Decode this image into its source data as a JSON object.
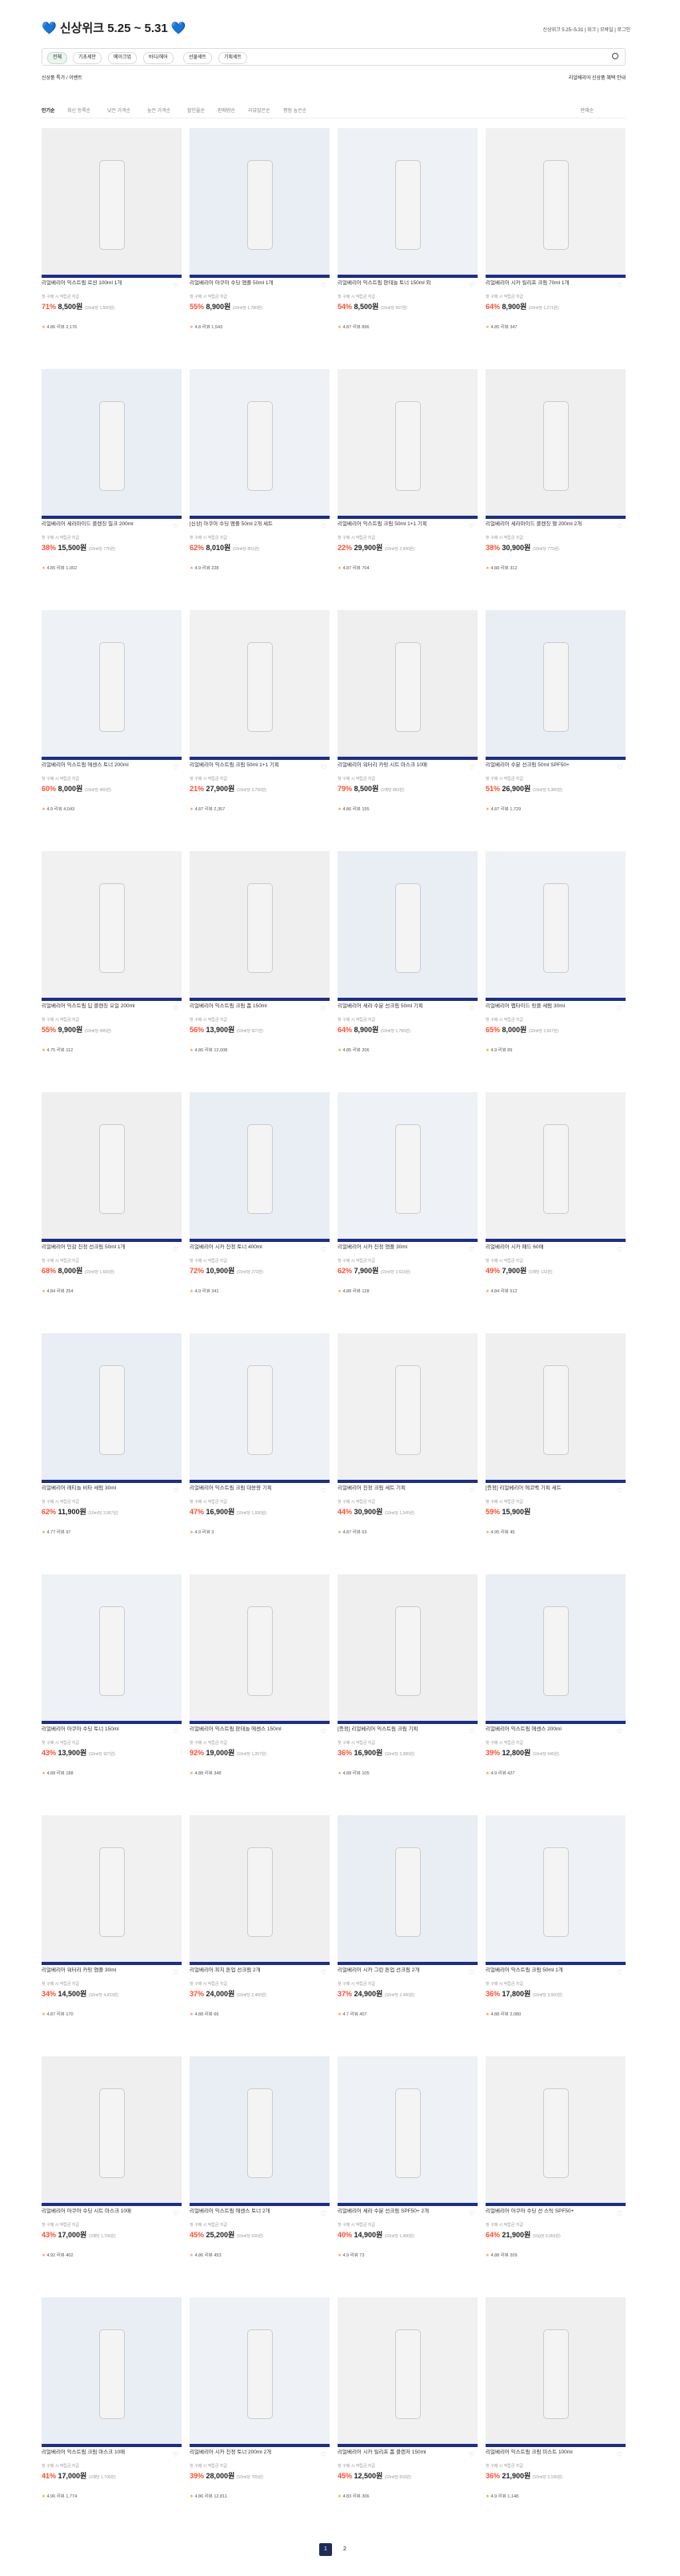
{
  "header": {
    "title": "💙 신상위크 5.25 ~ 5.31 💙",
    "right_text": "신상위크 5.25~5.31 | 위크 | 모바일 | 로그인"
  },
  "filters": {
    "items": [
      "전체",
      "기초세안",
      "메이크업",
      "바디/헤어",
      "선물세트",
      "기획세트"
    ],
    "active_index": 0
  },
  "subbar": {
    "left": "신상품 특가 / 이벤트",
    "right": "리얼베리어 신상품 혜택 안내"
  },
  "tabs": {
    "items": [
      "인기순",
      "최신 등록순",
      "낮은 가격순",
      "높은 가격순",
      "할인율순",
      "판매량순",
      "리뷰많은순",
      "평점 높은순"
    ],
    "sort_label": "판매순",
    "active_index": 0
  },
  "products": [
    {
      "name": "리얼베리어 익스트림 로션 100ml 1개",
      "desc": "첫 구매 시 적립금 지급",
      "discount": "71%",
      "price": "8,500원",
      "unit": "(10ml당 1,500원)",
      "rating": "4.86",
      "reviews": "리뷰 2,176"
    },
    {
      "name": "리얼베리어 아쿠아 수딩 앰플 50ml 1개",
      "desc": "첫 구매 시 적립금 지급",
      "discount": "55%",
      "price": "8,900원",
      "unit": "(10ml당 1,780원)",
      "rating": "4.8",
      "reviews": "리뷰 1,543"
    },
    {
      "name": "리얼베리어 익스트림 판테놀 토너 150ml 외",
      "desc": "첫 구매 시 적립금 지급",
      "discount": "54%",
      "price": "8,500원",
      "unit": "(10ml당 567원)",
      "rating": "4.87",
      "reviews": "리뷰 896"
    },
    {
      "name": "리얼베리어 시카 릴리프 크림 70ml 1개",
      "desc": "첫 구매 시 적립금 지급",
      "discount": "64%",
      "price": "8,900원",
      "unit": "(10ml당 1,271원)",
      "rating": "4.85",
      "reviews": "리뷰 347"
    },
    {
      "name": "리얼베리어 세라마이드 클렌징 밀크 200ml",
      "desc": "첫 구매 시 적립금 지급",
      "discount": "38%",
      "price": "15,500원",
      "unit": "(10ml당 775원)",
      "rating": "4.85",
      "reviews": "리뷰 1,002"
    },
    {
      "name": "[신상] 아쿠아 수딩 앰플 50ml 2개 세트",
      "desc": "첫 구매 시 적립금 지급",
      "discount": "62%",
      "price": "8,010원",
      "unit": "(10ml당 801원)",
      "rating": "4.9",
      "reviews": "리뷰 228"
    },
    {
      "name": "리얼베리어 익스트림 크림 50ml 1+1 기획",
      "desc": "첫 구매 시 적립금 지급",
      "discount": "22%",
      "price": "29,900원",
      "unit": "(10ml당 2,990원)",
      "rating": "4.87",
      "reviews": "리뷰 704"
    },
    {
      "name": "리얼베리어 세라마이드 클렌징 젤 200ml 2개",
      "desc": "첫 구매 시 적립금 지급",
      "discount": "38%",
      "price": "30,900원",
      "unit": "(10ml당 773원)",
      "rating": "4.88",
      "reviews": "리뷰 312"
    },
    {
      "name": "리얼베리어 익스트림 에센스 토너 200ml",
      "desc": "첫 구매 시 적립금 지급",
      "discount": "60%",
      "price": "8,000원",
      "unit": "(10ml당 400원)",
      "rating": "4.9",
      "reviews": "리뷰 4,043"
    },
    {
      "name": "리얼베리어 익스트림 크림 50ml 1+1 기획",
      "desc": "첫 구매 시 적립금 지급",
      "discount": "21%",
      "price": "27,900원",
      "unit": "(10ml당 2,790원)",
      "rating": "4.87",
      "reviews": "리뷰 2,357"
    },
    {
      "name": "리얼베리어 워터리 카밍 시트 마스크 10매",
      "desc": "첫 구매 시 적립금 지급",
      "discount": "79%",
      "price": "8,500원",
      "unit": "(1매당 850원)",
      "rating": "4.86",
      "reviews": "리뷰 155"
    },
    {
      "name": "리얼베리어 수분 선크림 50ml SPF50+",
      "desc": "첫 구매 시 적립금 지급",
      "discount": "51%",
      "price": "26,900원",
      "unit": "(10ml당 5,380원)",
      "rating": "4.87",
      "reviews": "리뷰 1,729"
    },
    {
      "name": "리얼베리어 익스트림 딥 클렌징 오일 200ml",
      "desc": "첫 구매 시 적립금 지급",
      "discount": "55%",
      "price": "9,900원",
      "unit": "(10ml당 495원)",
      "rating": "4.75",
      "reviews": "리뷰 112"
    },
    {
      "name": "리얼베리어 익스트림 크림 폼 150ml",
      "desc": "첫 구매 시 적립금 지급",
      "discount": "56%",
      "price": "13,900원",
      "unit": "(10ml당 927원)",
      "rating": "4.86",
      "reviews": "리뷰 12,008"
    },
    {
      "name": "리얼베리어 세라 수분 선크림 50ml 기획",
      "desc": "첫 구매 시 적립금 지급",
      "discount": "64%",
      "price": "8,900원",
      "unit": "(10ml당 1,780원)",
      "rating": "4.85",
      "reviews": "리뷰 206"
    },
    {
      "name": "리얼베리어 펩타이드 링클 세럼 30ml",
      "desc": "첫 구매 시 적립금 지급",
      "discount": "65%",
      "price": "8,000원",
      "unit": "(10ml당 2,667원)",
      "rating": "4.9",
      "reviews": "리뷰 89"
    },
    {
      "name": "리얼베리어 민감 진정 선크림 50ml 1개",
      "desc": "첫 구매 시 적립금 지급",
      "discount": "68%",
      "price": "8,000원",
      "unit": "(10ml당 1,600원)",
      "rating": "4.84",
      "reviews": "리뷰 254"
    },
    {
      "name": "리얼베리어 시카 진정 토너 400ml",
      "desc": "첫 구매 시 적립금 지급",
      "discount": "72%",
      "price": "10,900원",
      "unit": "(10ml당 273원)",
      "rating": "4.9",
      "reviews": "리뷰 341"
    },
    {
      "name": "리얼베리어 시카 진정 앰플 30ml",
      "desc": "첫 구매 시 적립금 지급",
      "discount": "62%",
      "price": "7,900원",
      "unit": "(10ml당 2,633원)",
      "rating": "4.88",
      "reviews": "리뷰 128"
    },
    {
      "name": "리얼베리어 시카 패드 60매",
      "desc": "첫 구매 시 적립금 지급",
      "discount": "49%",
      "price": "7,900원",
      "unit": "(1매당 132원)",
      "rating": "4.84",
      "reviews": "리뷰 512"
    },
    {
      "name": "리얼베리어 레티놀 비타 세럼 30ml",
      "desc": "첫 구매 시 적립금 지급",
      "discount": "62%",
      "price": "11,900원",
      "unit": "(10ml당 3,967원)",
      "rating": "4.77",
      "reviews": "리뷰 97"
    },
    {
      "name": "리얼베리어 익스트림 크림 대용량 기획",
      "desc": "첫 구매 시 적립금 지급",
      "discount": "47%",
      "price": "16,900원",
      "unit": "(10ml당 1,690원)",
      "rating": "4.9",
      "reviews": "리뷰 3"
    },
    {
      "name": "리얼베리어 진정 크림 세트 기획",
      "desc": "첫 구매 시 적립금 지급",
      "discount": "44%",
      "price": "30,900원",
      "unit": "(10ml당 1,545원)",
      "rating": "4.87",
      "reviews": "리뷰 63"
    },
    {
      "name": "[증정] 리얼베리어 에코백 기획 세트",
      "desc": "첫 구매 시 적립금 지급",
      "discount": "59%",
      "price": "15,900원",
      "unit": "",
      "rating": "4.95",
      "reviews": "리뷰 45"
    },
    {
      "name": "리얼베리어 아쿠아 수딩 토너 150ml",
      "desc": "첫 구매 시 적립금 지급",
      "discount": "43%",
      "price": "13,900원",
      "unit": "(10ml당 927원)",
      "rating": "4.88",
      "reviews": "리뷰 188"
    },
    {
      "name": "리얼베리어 익스트림 판테놀 에센스 150ml",
      "desc": "첫 구매 시 적립금 지급",
      "discount": "92%",
      "price": "19,000원",
      "unit": "(10ml당 1,267원)",
      "rating": "4.88",
      "reviews": "리뷰 348"
    },
    {
      "name": "[증정] 리얼베리어 익스트림 크림 기획",
      "desc": "첫 구매 시 적립금 지급",
      "discount": "36%",
      "price": "16,900원",
      "unit": "(10ml당 3,380원)",
      "rating": "4.88",
      "reviews": "리뷰 105"
    },
    {
      "name": "리얼베리어 익스트림 에센스 200ml",
      "desc": "첫 구매 시 적립금 지급",
      "discount": "39%",
      "price": "12,800원",
      "unit": "(10ml당 640원)",
      "rating": "4.9",
      "reviews": "리뷰 427"
    },
    {
      "name": "리얼베리어 워터리 카밍 앰플 30ml",
      "desc": "첫 구매 시 적립금 지급",
      "discount": "34%",
      "price": "14,500원",
      "unit": "(10ml당 4,833원)",
      "rating": "4.87",
      "reviews": "리뷰 170"
    },
    {
      "name": "리얼베리어 피치 톤업 선크림 2개",
      "desc": "첫 구매 시 적립금 지급",
      "discount": "37%",
      "price": "24,000원",
      "unit": "(10ml당 2,400원)",
      "rating": "4.88",
      "reviews": "리뷰 66"
    },
    {
      "name": "리얼베리어 시카 그린 톤업 선크림 2개",
      "desc": "첫 구매 시 적립금 지급",
      "discount": "37%",
      "price": "24,900원",
      "unit": "(10ml당 2,490원)",
      "rating": "4.7",
      "reviews": "리뷰 407"
    },
    {
      "name": "리얼베리어 익스트림 크림 50ml 1개",
      "desc": "첫 구매 시 적립금 지급",
      "discount": "36%",
      "price": "17,800원",
      "unit": "(10ml당 3,560원)",
      "rating": "4.88",
      "reviews": "리뷰 2,080"
    },
    {
      "name": "리얼베리어 아쿠아 수딩 시트 마스크 10매",
      "desc": "첫 구매 시 적립금 지급",
      "discount": "43%",
      "price": "17,000원",
      "unit": "(1매당 1,700원)",
      "rating": "4.92",
      "reviews": "리뷰 402"
    },
    {
      "name": "리얼베리어 익스트림 에센스 토너 2개",
      "desc": "첫 구매 시 적립금 지급",
      "discount": "45%",
      "price": "25,200원",
      "unit": "(10ml당 630원)",
      "rating": "4.86",
      "reviews": "리뷰 453"
    },
    {
      "name": "리얼베리어 세라 수분 선크림 SPF50+ 2개",
      "desc": "첫 구매 시 적립금 지급",
      "discount": "40%",
      "price": "14,900원",
      "unit": "(10ml당 1,490원)",
      "rating": "4.9",
      "reviews": "리뷰 73"
    },
    {
      "name": "리얼베리어 아쿠아 수딩 선 스틱 SPF50+",
      "desc": "첫 구매 시 적립금 지급",
      "discount": "64%",
      "price": "21,900원",
      "unit": "(10g당 9,955원)",
      "rating": "4.88",
      "reviews": "리뷰 209"
    },
    {
      "name": "리얼베리어 익스트림 크림 마스크 10매",
      "desc": "첫 구매 시 적립금 지급",
      "discount": "41%",
      "price": "17,000원",
      "unit": "(1매당 1,700원)",
      "rating": "4.96",
      "reviews": "리뷰 1,774"
    },
    {
      "name": "리얼베리어 시카 진정 토너 200ml 2개",
      "desc": "첫 구매 시 적립금 지급",
      "discount": "39%",
      "price": "28,000원",
      "unit": "(10ml당 700원)",
      "rating": "4.86",
      "reviews": "리뷰 12,811"
    },
    {
      "name": "리얼베리어 시카 릴리프 폼 클렌저 150ml",
      "desc": "첫 구매 시 적립금 지급",
      "discount": "45%",
      "price": "12,500원",
      "unit": "(10ml당 833원)",
      "rating": "4.83",
      "reviews": "리뷰 306"
    },
    {
      "name": "리얼베리어 익스트림 크림 미스트 100ml",
      "desc": "첫 구매 시 적립금 지급",
      "discount": "36%",
      "price": "21,900원",
      "unit": "(10ml당 2,190원)",
      "rating": "4.9",
      "reviews": "리뷰 1,148"
    }
  ],
  "pagination": {
    "pages": [
      "1",
      "2"
    ],
    "current": "1"
  },
  "colors": {
    "accent": "#1c2e8c",
    "discount": "#ff4d2e",
    "active_pill": "#eaf6ee"
  }
}
